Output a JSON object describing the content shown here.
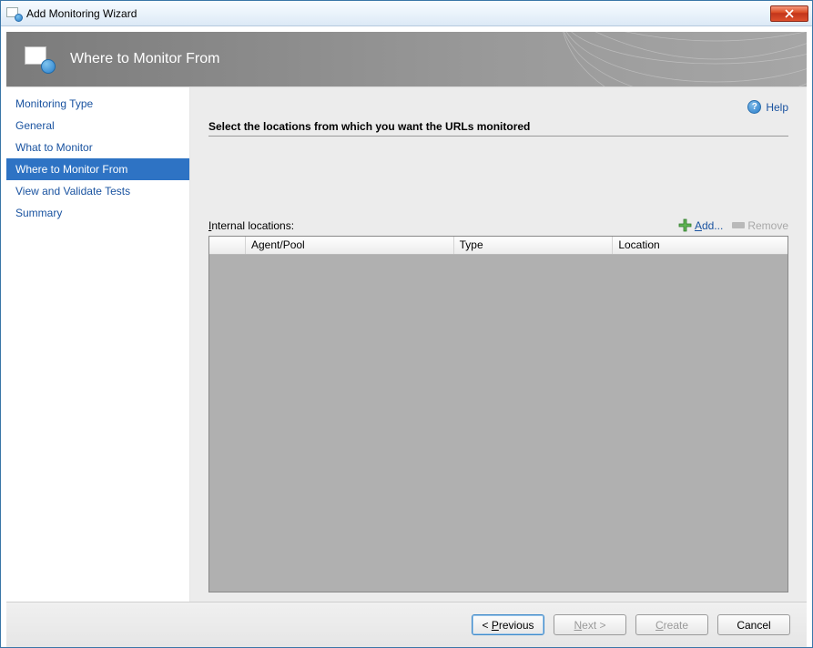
{
  "window": {
    "title": "Add Monitoring Wizard"
  },
  "banner": {
    "title": "Where to Monitor From"
  },
  "sidebar": {
    "items": [
      {
        "label": "Monitoring Type",
        "selected": false
      },
      {
        "label": "General",
        "selected": false
      },
      {
        "label": "What to Monitor",
        "selected": false
      },
      {
        "label": "Where to Monitor From",
        "selected": true
      },
      {
        "label": "View and Validate Tests",
        "selected": false
      },
      {
        "label": "Summary",
        "selected": false
      }
    ]
  },
  "main": {
    "help_label": "Help",
    "section_title": "Select the locations from which you want the URLs monitored",
    "table_label_prefix": "I",
    "table_label_rest": "nternal locations:",
    "add_label_prefix": "A",
    "add_label_rest": "dd...",
    "remove_label": "Remove",
    "columns": {
      "agent_pool": "Agent/Pool",
      "type": "Type",
      "location": "Location"
    }
  },
  "footer": {
    "previous_prefix": "< ",
    "previous_u": "P",
    "previous_rest": "revious",
    "next_u": "N",
    "next_rest": "ext >",
    "create_u": "C",
    "create_rest": "reate",
    "cancel": "Cancel"
  }
}
